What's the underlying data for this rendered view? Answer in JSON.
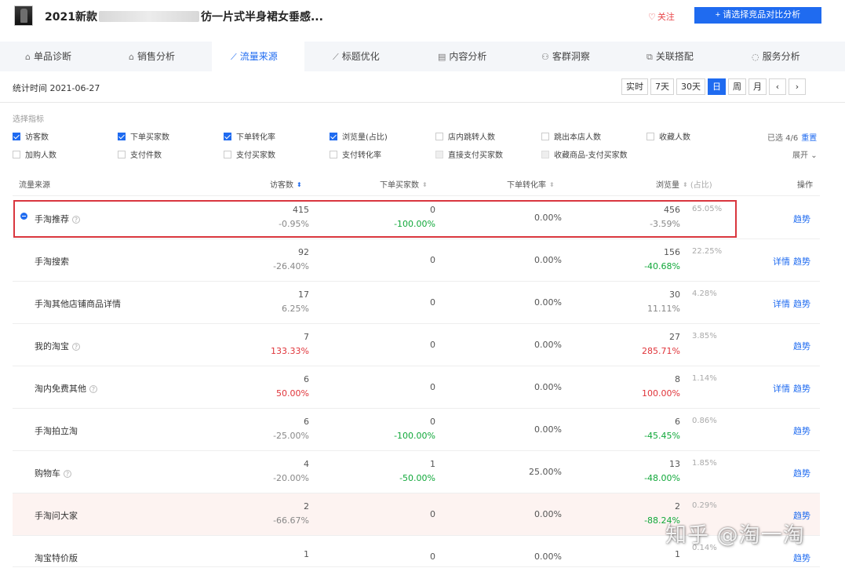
{
  "header": {
    "title_prefix": "2021新款",
    "title_suffix": "彷一片式半身裙女垂感...",
    "follow_label": "关注",
    "compare_button": "+ 请选择竞品对比分析"
  },
  "tabs": [
    {
      "label": "单品诊断",
      "icon": "bag-icon"
    },
    {
      "label": "销售分析",
      "icon": "bag-icon"
    },
    {
      "label": "流量来源",
      "icon": "line-chart-icon",
      "active": true
    },
    {
      "label": "标题优化",
      "icon": "line-chart-icon"
    },
    {
      "label": "内容分析",
      "icon": "document-icon"
    },
    {
      "label": "客群洞察",
      "icon": "users-icon"
    },
    {
      "label": "关联搭配",
      "icon": "link-icon"
    },
    {
      "label": "服务分析",
      "icon": "headset-icon"
    }
  ],
  "date_row": {
    "stat_time": "统计时间 2021-06-27",
    "ranges": [
      "实时",
      "7天",
      "30天",
      "日",
      "周",
      "月"
    ],
    "active_range": "日",
    "prev": "‹",
    "next": "›"
  },
  "metrics": {
    "label": "选择指标",
    "items": [
      {
        "label": "访客数",
        "checked": true
      },
      {
        "label": "下单买家数",
        "checked": true
      },
      {
        "label": "下单转化率",
        "checked": true
      },
      {
        "label": "浏览量(占比)",
        "checked": true
      },
      {
        "label": "店内跳转人数",
        "checked": false
      },
      {
        "label": "跳出本店人数",
        "checked": false
      },
      {
        "label": "收藏人数",
        "checked": false
      },
      {
        "label": "加购人数",
        "checked": false
      },
      {
        "label": "支付件数",
        "checked": false
      },
      {
        "label": "支付买家数",
        "checked": false
      },
      {
        "label": "支付转化率",
        "checked": false
      },
      {
        "label": "直接支付买家数",
        "checked": false
      },
      {
        "label": "收藏商品-支付买家数",
        "checked": false
      }
    ],
    "selected_count": "已选 4/6",
    "reset": "重置",
    "expand": "展开"
  },
  "table": {
    "headers": {
      "source": "流量来源",
      "visitors": "访客数",
      "buyers": "下单买家数",
      "conversion": "下单转化率",
      "pageviews": "浏览量",
      "share": "(占比)",
      "actions": "操作"
    },
    "rows": [
      {
        "source": "手淘推荐",
        "help": true,
        "expand": true,
        "visitors": "415",
        "visitors_change": "-0.95%",
        "buyers": "0",
        "buyers_change": "-100.00%",
        "conversion": "0.00%",
        "pv": "456",
        "pv_share": "65.05%",
        "pv_change": "-3.59%",
        "actions": [
          "趋势"
        ]
      },
      {
        "source": "手淘搜索",
        "visitors": "92",
        "visitors_change": "-26.40%",
        "buyers": "0",
        "buyers_change": "",
        "conversion": "0.00%",
        "pv": "156",
        "pv_share": "22.25%",
        "pv_change": "-40.68%",
        "actions": [
          "详情",
          "趋势"
        ]
      },
      {
        "source": "手淘其他店铺商品详情",
        "visitors": "17",
        "visitors_change": "6.25%",
        "buyers": "0",
        "buyers_change": "",
        "conversion": "0.00%",
        "pv": "30",
        "pv_share": "4.28%",
        "pv_change": "11.11%",
        "actions": [
          "详情",
          "趋势"
        ]
      },
      {
        "source": "我的淘宝",
        "help": true,
        "visitors": "7",
        "visitors_change": "133.33%",
        "buyers": "0",
        "buyers_change": "",
        "conversion": "0.00%",
        "pv": "27",
        "pv_share": "3.85%",
        "pv_change": "285.71%",
        "actions": [
          "趋势"
        ]
      },
      {
        "source": "淘内免费其他",
        "help": true,
        "visitors": "6",
        "visitors_change": "50.00%",
        "buyers": "0",
        "buyers_change": "",
        "conversion": "0.00%",
        "pv": "8",
        "pv_share": "1.14%",
        "pv_change": "100.00%",
        "actions": [
          "详情",
          "趋势"
        ]
      },
      {
        "source": "手淘拍立淘",
        "visitors": "6",
        "visitors_change": "-25.00%",
        "buyers": "0",
        "buyers_change": "-100.00%",
        "conversion": "0.00%",
        "pv": "6",
        "pv_share": "0.86%",
        "pv_change": "-45.45%",
        "actions": [
          "趋势"
        ]
      },
      {
        "source": "购物车",
        "help": true,
        "visitors": "4",
        "visitors_change": "-20.00%",
        "buyers": "1",
        "buyers_change": "-50.00%",
        "conversion": "25.00%",
        "pv": "13",
        "pv_share": "1.85%",
        "pv_change": "-48.00%",
        "actions": [
          "趋势"
        ]
      },
      {
        "source": "手淘问大家",
        "visitors": "2",
        "visitors_change": "-66.67%",
        "buyers": "0",
        "buyers_change": "",
        "conversion": "0.00%",
        "pv": "2",
        "pv_share": "0.29%",
        "pv_change": "-88.24%",
        "actions": [
          "趋势"
        ]
      },
      {
        "source": "淘宝特价版",
        "visitors": "1",
        "visitors_change": "",
        "buyers": "0",
        "buyers_change": "",
        "conversion": "0.00%",
        "pv": "1",
        "pv_share": "0.14%",
        "pv_change": "",
        "actions": [
          "趋势"
        ]
      }
    ]
  },
  "watermark": "知乎 @淘一淘"
}
